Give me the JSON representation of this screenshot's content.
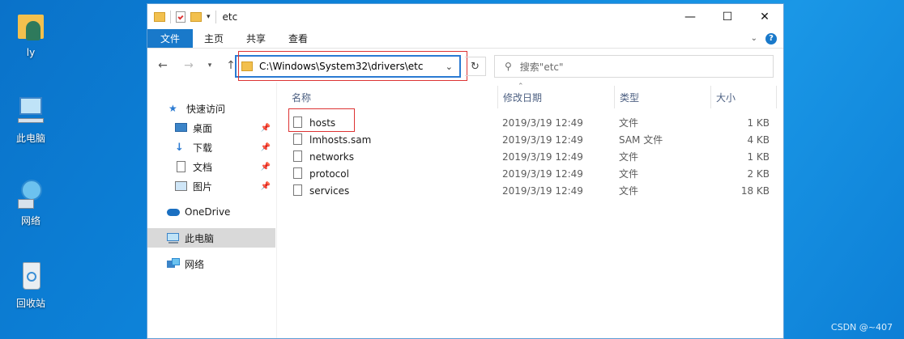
{
  "desktop": {
    "icons": [
      {
        "label": "ly"
      },
      {
        "label": "此电脑"
      },
      {
        "label": "网络"
      },
      {
        "label": "回收站"
      }
    ],
    "watermark": "CSDN @~407"
  },
  "window": {
    "title": "etc",
    "ribbon_tabs": [
      "文件",
      "主页",
      "共享",
      "查看"
    ],
    "address": "C:\\Windows\\System32\\drivers\\etc",
    "search_placeholder": "搜索\"etc\"",
    "controls": {
      "minimize": "—",
      "maximize": "☐",
      "close": "✕"
    }
  },
  "nav": {
    "items": [
      {
        "label": "快速访问"
      },
      {
        "label": "桌面"
      },
      {
        "label": "下载"
      },
      {
        "label": "文档"
      },
      {
        "label": "图片"
      },
      {
        "label": "OneDrive"
      },
      {
        "label": "此电脑"
      },
      {
        "label": "网络"
      }
    ]
  },
  "files": {
    "columns": [
      "名称",
      "修改日期",
      "类型",
      "大小"
    ],
    "rows": [
      {
        "name": "hosts",
        "date": "2019/3/19 12:49",
        "type": "文件",
        "size": "1 KB"
      },
      {
        "name": "lmhosts.sam",
        "date": "2019/3/19 12:49",
        "type": "SAM 文件",
        "size": "4 KB"
      },
      {
        "name": "networks",
        "date": "2019/3/19 12:49",
        "type": "文件",
        "size": "1 KB"
      },
      {
        "name": "protocol",
        "date": "2019/3/19 12:49",
        "type": "文件",
        "size": "2 KB"
      },
      {
        "name": "services",
        "date": "2019/3/19 12:49",
        "type": "文件",
        "size": "18 KB"
      }
    ]
  },
  "colors": {
    "accent": "#1979ca",
    "highlight_red": "#dd3333",
    "desktop_blue": "#0e86dc"
  }
}
